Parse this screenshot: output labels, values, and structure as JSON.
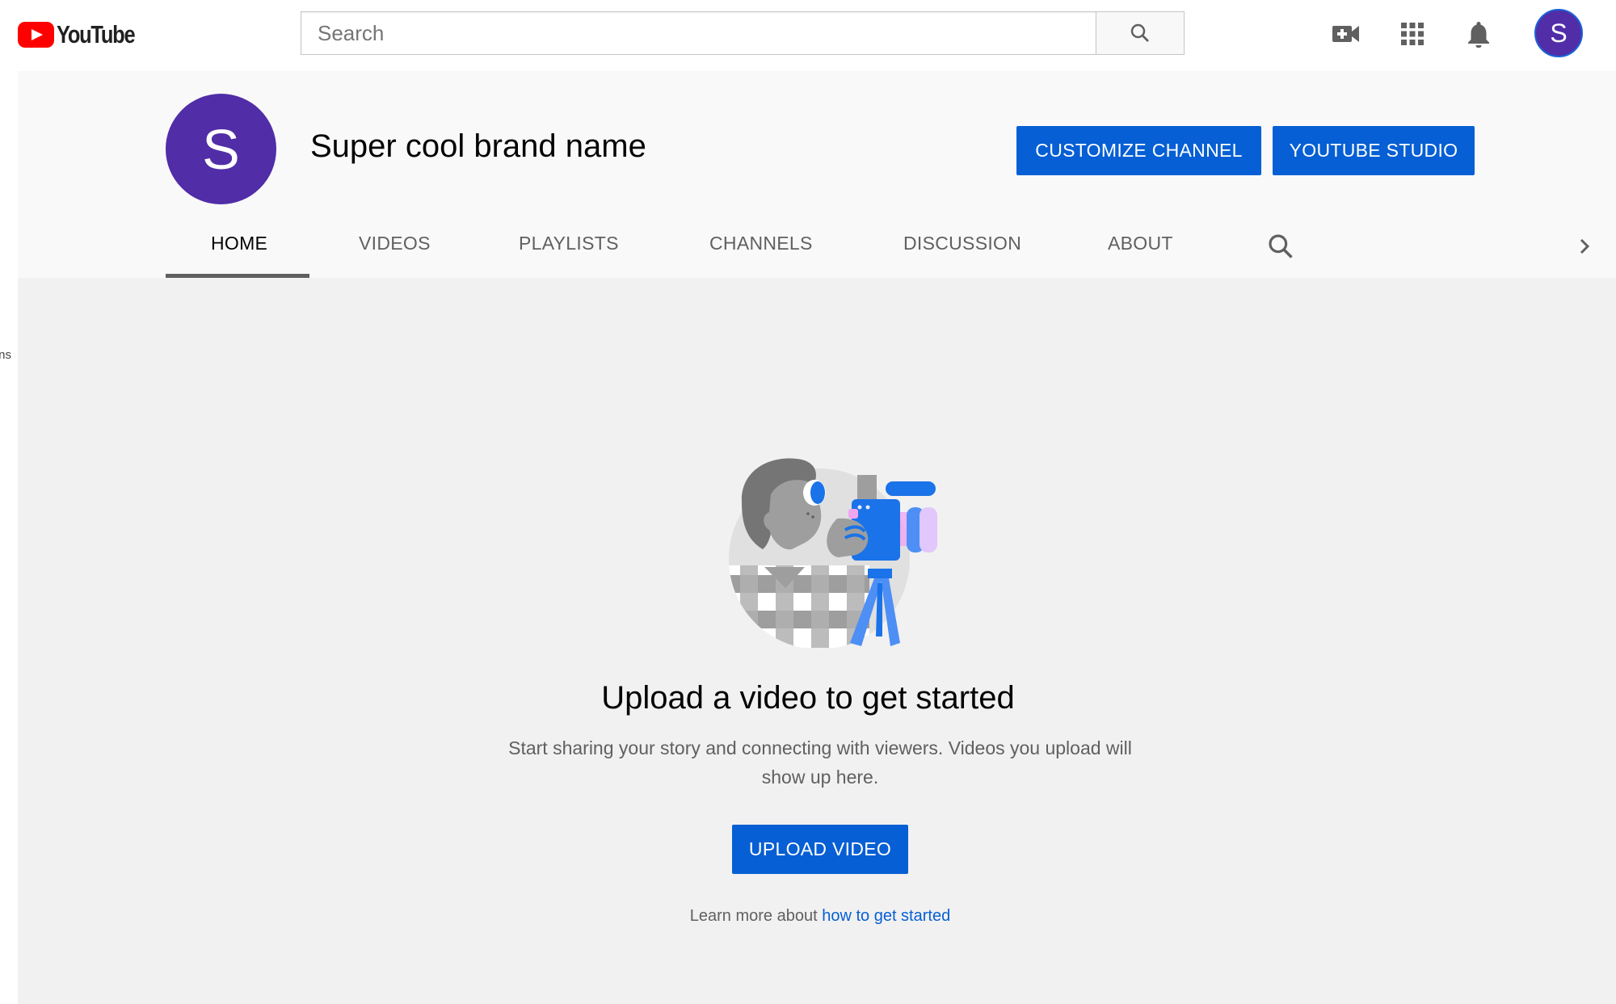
{
  "masthead": {
    "logo_text": "YouTube",
    "search_placeholder": "Search",
    "search_value": "",
    "icons": [
      "create-video-icon",
      "apps-grid-icon",
      "notifications-bell-icon"
    ],
    "account_initial": "S",
    "account_color": "#512da8"
  },
  "guide_peek_text": "ns",
  "channel": {
    "avatar_initial": "S",
    "avatar_color": "#512da8",
    "name": "Super cool brand name",
    "customize_label": "CUSTOMIZE CHANNEL",
    "studio_label": "YOUTUBE STUDIO",
    "button_color": "#065fd4",
    "tabs": [
      {
        "label": "HOME",
        "active": true
      },
      {
        "label": "VIDEOS",
        "active": false
      },
      {
        "label": "PLAYLISTS",
        "active": false
      },
      {
        "label": "CHANNELS",
        "active": false
      },
      {
        "label": "DISCUSSION",
        "active": false
      },
      {
        "label": "ABOUT",
        "active": false
      }
    ]
  },
  "empty_state": {
    "illustration": "person-filming-with-camera-illustration",
    "title": "Upload a video to get started",
    "description": "Start sharing your story and connecting with viewers. Videos you upload will show up here.",
    "upload_label": "UPLOAD VIDEO",
    "learn_prefix": "Learn more about ",
    "learn_link": "how to get started"
  }
}
